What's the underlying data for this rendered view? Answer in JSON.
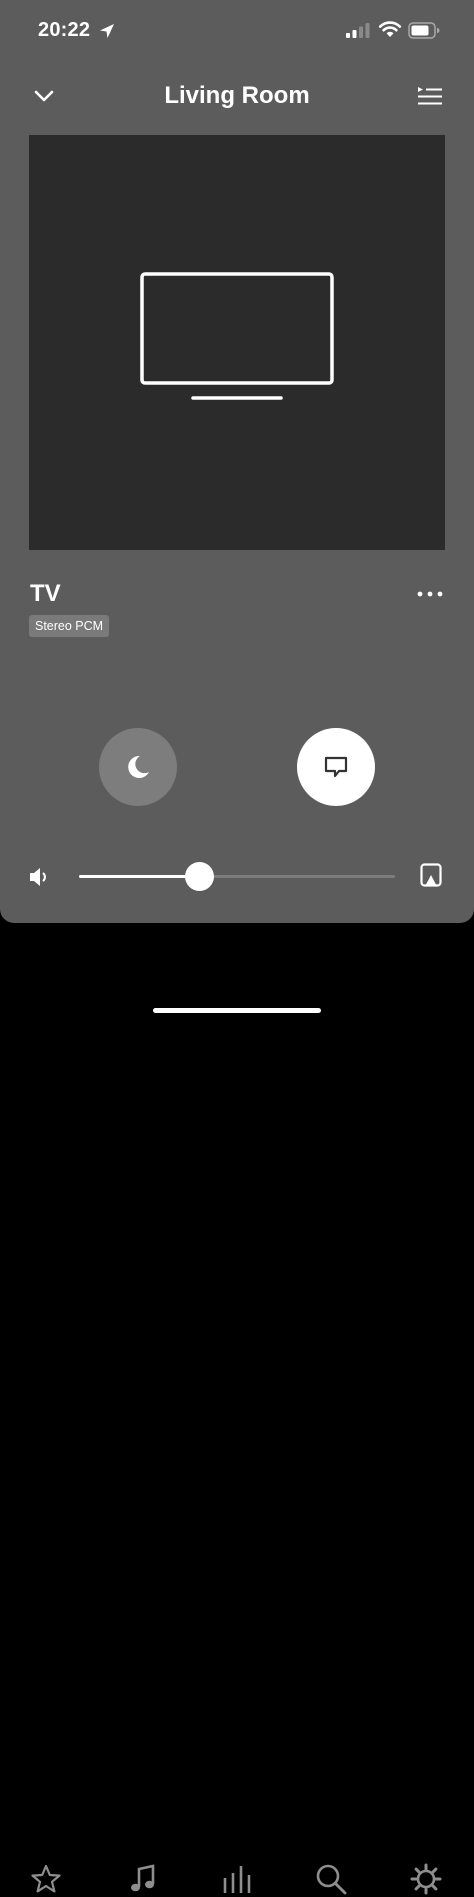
{
  "status_bar": {
    "time": "20:22",
    "icons": [
      "location-arrow-icon",
      "cellular-signal-icon",
      "wifi-icon",
      "battery-icon"
    ]
  },
  "header": {
    "title": "Living Room",
    "left_icon": "chevron-down-icon",
    "right_icon": "queue-icon"
  },
  "now_playing": {
    "artwork_icon": "tv-icon",
    "source_name": "TV",
    "format_badge": "Stereo PCM",
    "more_icon": "more-dots-icon"
  },
  "controls": {
    "night_mode_icon": "moon-icon",
    "speech_enhancement_icon": "speech-bubble-icon"
  },
  "volume": {
    "level": 0.38,
    "speaker_icon": "volume-speaker-icon",
    "output_icon": "airplay-icon"
  },
  "tab_bar": {
    "tabs": [
      "favorites-icon",
      "music-icon",
      "rooms-icon",
      "search-icon",
      "settings-icon"
    ]
  },
  "colors": {
    "panel_background": "#5c5c5c",
    "artwork_background": "#2b2b2b",
    "night_button": "#7d7d7d",
    "tab_icon": "#8e8e8e"
  }
}
